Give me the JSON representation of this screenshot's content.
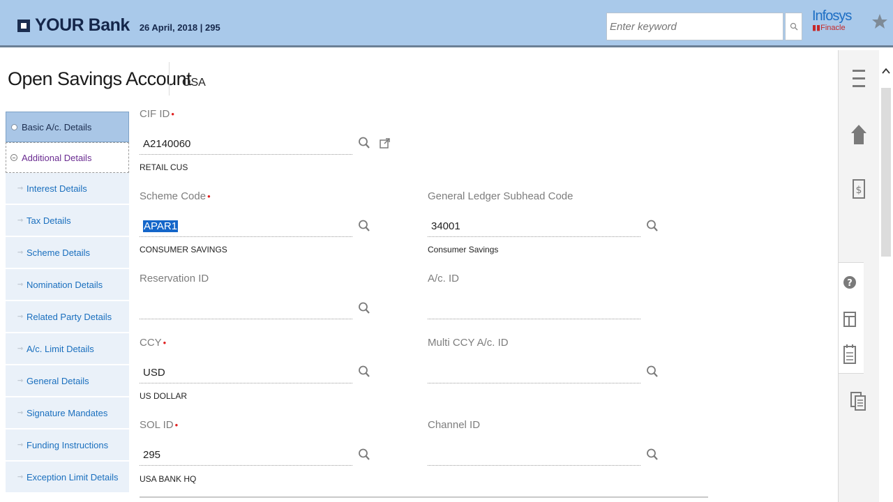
{
  "header": {
    "bank_name": "YOUR Bank",
    "date_info": "26 April, 2018 | 295",
    "search_placeholder": "Enter keyword",
    "vendor_name": "Infosys",
    "vendor_product": "Finacle",
    "colors": {
      "header_bg": "#a9c9ea",
      "brand": "#14264a"
    }
  },
  "page": {
    "title": "Open Savings Account",
    "code": "OSA"
  },
  "nav": {
    "items": [
      {
        "label": "Basic A/c. Details",
        "state": "active"
      },
      {
        "label": "Additional Details",
        "state": "expanded"
      },
      {
        "label": "Interest Details",
        "state": "sub"
      },
      {
        "label": "Tax Details",
        "state": "sub"
      },
      {
        "label": "Scheme Details",
        "state": "sub"
      },
      {
        "label": "Nomination Details",
        "state": "sub"
      },
      {
        "label": "Related Party Details",
        "state": "sub"
      },
      {
        "label": "A/c. Limit Details",
        "state": "sub"
      },
      {
        "label": "General Details",
        "state": "sub"
      },
      {
        "label": "Signature Mandates",
        "state": "sub"
      },
      {
        "label": "Funding Instructions",
        "state": "sub"
      },
      {
        "label": "Exception Limit Details",
        "state": "sub"
      }
    ]
  },
  "form": {
    "cif_id": {
      "label": "CIF ID",
      "required": "•",
      "value": "A2140060",
      "desc": "RETAIL CUS"
    },
    "scheme_code": {
      "label": "Scheme Code",
      "required": "•",
      "value": "APAR1",
      "desc": "CONSUMER SAVINGS"
    },
    "gl_subhead": {
      "label": "General Ledger Subhead Code",
      "value": "34001",
      "desc": "Consumer Savings"
    },
    "reservation_id": {
      "label": "Reservation ID",
      "value": ""
    },
    "ac_id": {
      "label": "A/c. ID",
      "value": ""
    },
    "ccy": {
      "label": "CCY",
      "required": "•",
      "value": "USD",
      "desc": "US DOLLAR"
    },
    "multi_ccy": {
      "label": "Multi CCY A/c. ID",
      "value": ""
    },
    "sol_id": {
      "label": "SOL ID",
      "required": "•",
      "value": "295",
      "desc": "USA BANK HQ"
    },
    "channel_id": {
      "label": "Channel ID",
      "value": ""
    }
  },
  "icons": {
    "lookup": "magnifier-icon",
    "external": "open-external-icon",
    "menu": "hamburger-icon",
    "home": "home-icon",
    "finance": "dollar-document-icon",
    "help": "help-icon",
    "layout": "layout-icon",
    "notes": "notepad-icon",
    "docs": "documents-icon",
    "favorite": "star-icon"
  }
}
